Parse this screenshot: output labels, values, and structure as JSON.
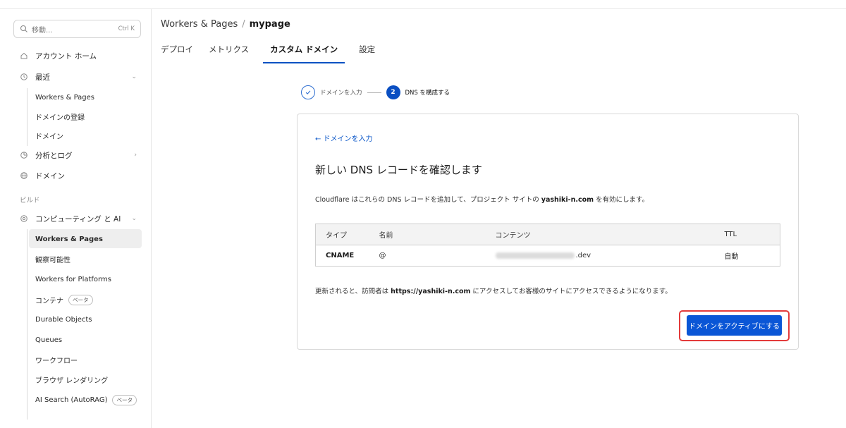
{
  "sidebar": {
    "search_placeholder": "移動...",
    "search_shortcut": "Ctrl K",
    "account_home": "アカウント ホーム",
    "recent": "最近",
    "recent_items": [
      "Workers & Pages",
      "ドメインの登録",
      "ドメイン"
    ],
    "analytics": "分析とログ",
    "domains": "ドメイン",
    "build_label": "ビルド",
    "compute_ai": "コンピューティング と AI",
    "compute_items": [
      {
        "label": "Workers & Pages",
        "badge": ""
      },
      {
        "label": "観察可能性",
        "badge": ""
      },
      {
        "label": "Workers for Platforms",
        "badge": ""
      },
      {
        "label": "コンテナ",
        "badge": "ベータ"
      },
      {
        "label": "Durable Objects",
        "badge": ""
      },
      {
        "label": "Queues",
        "badge": ""
      },
      {
        "label": "ワークフロー",
        "badge": ""
      },
      {
        "label": "ブラウザ レンダリング",
        "badge": ""
      },
      {
        "label": "AI Search (AutoRAG)",
        "badge": "ベータ"
      }
    ]
  },
  "header": {
    "breadcrumb_parent": "Workers & Pages",
    "breadcrumb_separator": "/",
    "breadcrumb_current": "mypage",
    "tabs": [
      "デプロイ",
      "メトリクス",
      "カスタム ドメイン",
      "設定"
    ]
  },
  "stepper": {
    "step1_label": "ドメインを入力",
    "step2_number": "2",
    "step2_label": "DNS を構成する"
  },
  "card": {
    "back_link": "← ドメインを入力",
    "title": "新しい DNS レコードを確認します",
    "desc_prefix": "Cloudflare はこれらの DNS レコードを追加して、プロジェクト サイトの ",
    "desc_domain": "yashiki-n.com",
    "desc_suffix": " を有効にします。",
    "table_headers": [
      "タイプ",
      "名前",
      "コンテンツ",
      "TTL"
    ],
    "row": {
      "type": "CNAME",
      "name": "@",
      "content_suffix": ".dev",
      "ttl": "自動"
    },
    "note_prefix": "更新されると、訪問者は ",
    "note_url": "https://yashiki-n.com",
    "note_suffix": " にアクセスしてお客様のサイトにアクセスできるようになります。",
    "activate_button": "ドメインをアクティブにする"
  },
  "colors": {
    "accent": "#0a56d6",
    "highlight": "#e33b3b"
  }
}
